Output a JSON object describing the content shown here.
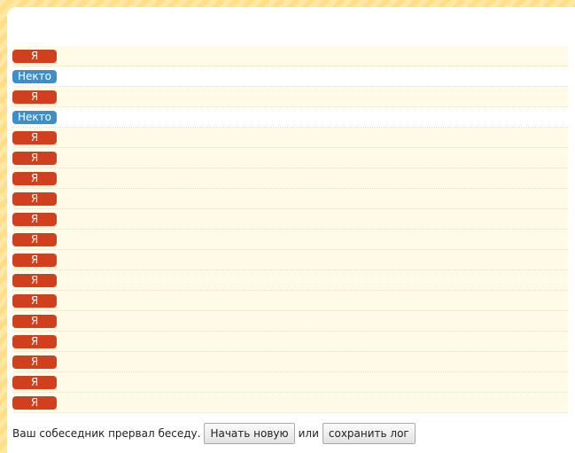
{
  "labels": {
    "me": "Я",
    "stranger": "Некто"
  },
  "messages": [
    {
      "sender": "me"
    },
    {
      "sender": "stranger"
    },
    {
      "sender": "me"
    },
    {
      "sender": "stranger"
    },
    {
      "sender": "me"
    },
    {
      "sender": "me"
    },
    {
      "sender": "me"
    },
    {
      "sender": "me"
    },
    {
      "sender": "me"
    },
    {
      "sender": "me"
    },
    {
      "sender": "me"
    },
    {
      "sender": "me"
    },
    {
      "sender": "me"
    },
    {
      "sender": "me"
    },
    {
      "sender": "me"
    },
    {
      "sender": "me"
    },
    {
      "sender": "me"
    },
    {
      "sender": "me"
    }
  ],
  "status": {
    "text": "Ваш собеседник прервал беседу.",
    "new_chat_button": "Начать новую",
    "or_text": "или",
    "save_log_button": "сохранить лог"
  },
  "colors": {
    "me_badge": "#d0401f",
    "stranger_badge": "#3e8ec8",
    "frame_bg": "#ffe59a"
  }
}
